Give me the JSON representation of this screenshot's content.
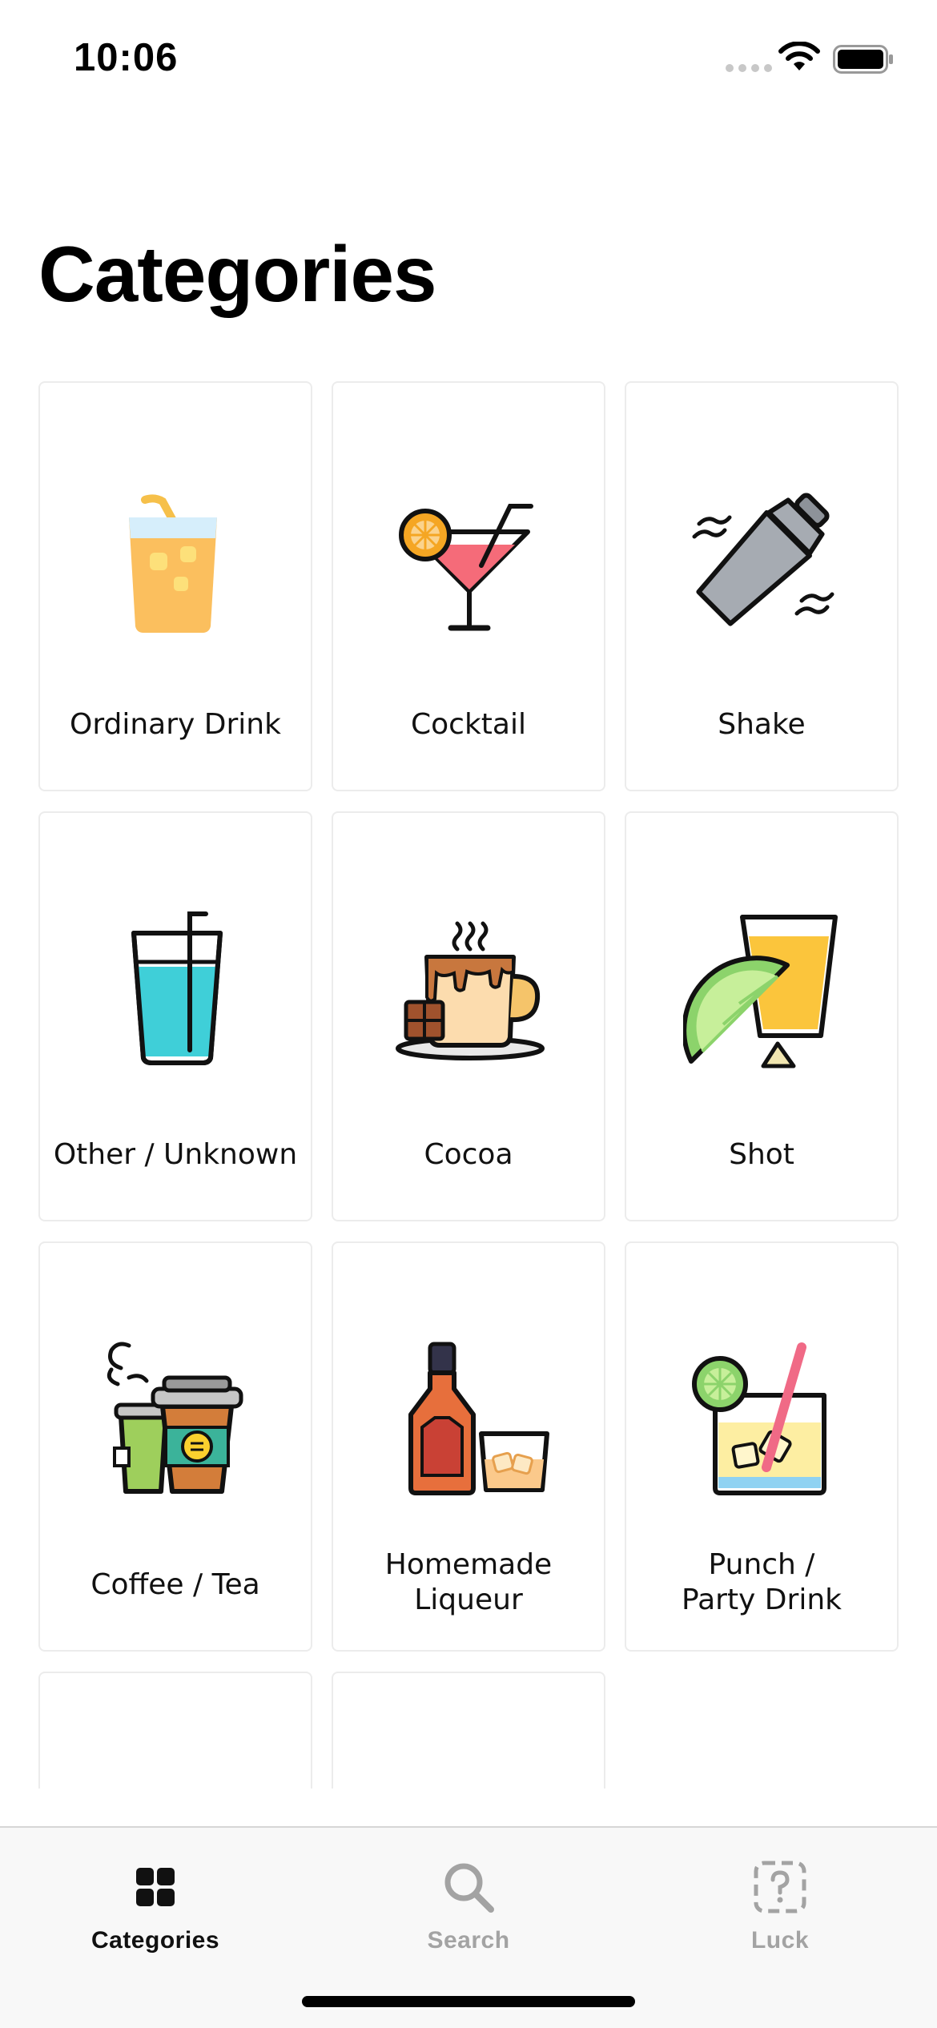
{
  "status_bar": {
    "time": "10:06"
  },
  "page": {
    "title": "Categories"
  },
  "categories": [
    {
      "label": "Ordinary Drink",
      "icon": "juice-glass-icon"
    },
    {
      "label": "Cocktail",
      "icon": "martini-cocktail-icon"
    },
    {
      "label": "Shake",
      "icon": "cocktail-shaker-icon"
    },
    {
      "label": "Other / Unknown",
      "icon": "water-glass-icon"
    },
    {
      "label": "Cocoa",
      "icon": "hot-cocoa-mug-icon"
    },
    {
      "label": "Shot",
      "icon": "tequila-shot-lime-icon"
    },
    {
      "label": "Coffee / Tea",
      "icon": "takeaway-coffee-cups-icon"
    },
    {
      "label": "Homemade\nLiqueur",
      "icon": "liqueur-bottle-glass-icon"
    },
    {
      "label": "Punch /\nParty Drink",
      "icon": "punch-glass-icon"
    },
    {
      "label": "",
      "icon": "partial-icon"
    },
    {
      "label": "",
      "icon": "partial-icon"
    }
  ],
  "tab_bar": {
    "tabs": [
      {
        "label": "Categories",
        "icon": "grid-icon",
        "active": true
      },
      {
        "label": "Search",
        "icon": "search-icon",
        "active": false
      },
      {
        "label": "Luck",
        "icon": "question-box-icon",
        "active": false
      }
    ]
  },
  "colors": {
    "active_tab": "#111111",
    "inactive_tab": "#a3a3a3",
    "card_border": "#ececec"
  }
}
